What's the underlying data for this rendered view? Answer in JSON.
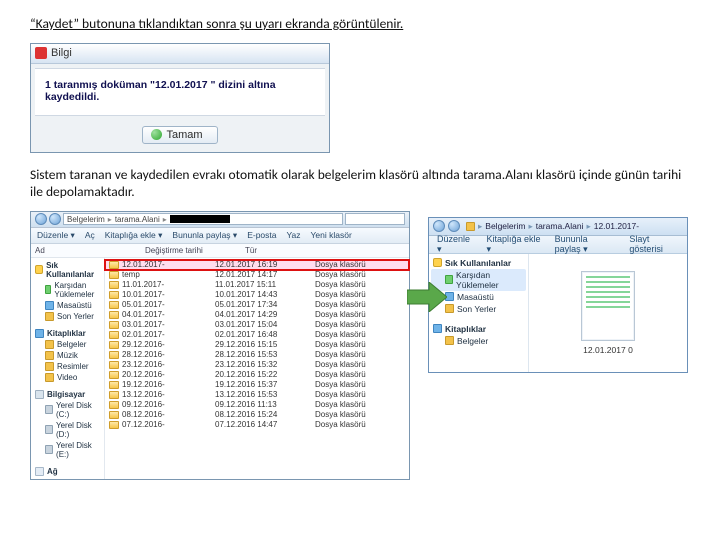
{
  "text": {
    "p1": "“Kaydet” butonuna tıklandıktan sonra şu uyarı ekranda görüntülenir.",
    "p2": "Sistem taranan ve kaydedilen evrakı otomatik olarak belgelerim klasörü altında tarama.Alanı klasörü içinde günün tarihi ile depolamaktadır."
  },
  "dialog": {
    "title": "Bilgi",
    "message": "1 taranmış doküman \"12.01.2017 \" dizini altına kaydedildi.",
    "ok": "Tamam"
  },
  "explorer": {
    "toolbar": {
      "duzenle": "Düzenle ▾",
      "ac": "Aç",
      "kitaplik": "Kitaplığa ekle ▾",
      "paylas": "Bununla paylaş ▾",
      "eposta": "E-posta",
      "yaz": "Yaz",
      "yeni": "Yeni klasör"
    },
    "addr": {
      "a": "Belgelerim",
      "b": "tarama.Alani"
    },
    "columns": {
      "ad": "Ad",
      "tarih": "Değiştirme tarihi",
      "tur": "Tür"
    },
    "side": {
      "sik": "Sık Kullanılanlar",
      "karsidan": "Karşıdan Yüklemeler",
      "masaustu": "Masaüstü",
      "son": "Son Yerler",
      "kitapliklar": "Kitaplıklar",
      "belgeler": "Belgeler",
      "muzik": "Müzik",
      "resimler": "Resimler",
      "video": "Video",
      "bilgisayar": "Bilgisayar",
      "yereldiskC": "Yerel Disk (C:)",
      "yereldiskD": "Yerel Disk (D:)",
      "yereldiskE": "Yerel Disk (E:)",
      "ag": "Ağ"
    },
    "rows": [
      {
        "name": "12.01.2017-",
        "date": "12.01.2017 16:19",
        "type": "Dosya klasörü",
        "sel": true
      },
      {
        "name": "temp",
        "date": "12.01.2017 14:17",
        "type": "Dosya klasörü"
      },
      {
        "name": "11.01.2017-",
        "date": "11.01.2017 15:11",
        "type": "Dosya klasörü"
      },
      {
        "name": "10.01.2017-",
        "date": "10.01.2017 14:43",
        "type": "Dosya klasörü"
      },
      {
        "name": "05.01.2017-",
        "date": "05.01.2017 17:34",
        "type": "Dosya klasörü"
      },
      {
        "name": "04.01.2017-",
        "date": "04.01.2017 14:29",
        "type": "Dosya klasörü"
      },
      {
        "name": "03.01.2017-",
        "date": "03.01.2017 15:04",
        "type": "Dosya klasörü"
      },
      {
        "name": "02.01.2017-",
        "date": "02.01.2017 16:48",
        "type": "Dosya klasörü"
      },
      {
        "name": "29.12.2016-",
        "date": "29.12.2016 15:15",
        "type": "Dosya klasörü"
      },
      {
        "name": "28.12.2016-",
        "date": "28.12.2016 15:53",
        "type": "Dosya klasörü"
      },
      {
        "name": "23.12.2016-",
        "date": "23.12.2016 15:32",
        "type": "Dosya klasörü"
      },
      {
        "name": "20.12.2016-",
        "date": "20.12.2016 15:22",
        "type": "Dosya klasörü"
      },
      {
        "name": "19.12.2016-",
        "date": "19.12.2016 15:37",
        "type": "Dosya klasörü"
      },
      {
        "name": "13.12.2016-",
        "date": "13.12.2016 15:53",
        "type": "Dosya klasörü"
      },
      {
        "name": "09.12.2016-",
        "date": "09.12.2016 11:13",
        "type": "Dosya klasörü"
      },
      {
        "name": "08.12.2016-",
        "date": "08.12.2016 15:24",
        "type": "Dosya klasörü"
      },
      {
        "name": "07.12.2016-",
        "date": "07.12.2016 14:47",
        "type": "Dosya klasörü"
      }
    ]
  },
  "explorer2": {
    "crumbs": {
      "a": "Belgelerim",
      "b": "tarama.Alani",
      "c": "12.01.2017-"
    },
    "toolbar": {
      "duzenle": "Düzenle ▾",
      "kitaplik": "Kitaplığa ekle ▾",
      "paylas": "Bununla paylaş ▾",
      "slayt": "Slayt gösterisi"
    },
    "side": {
      "sik": "Sık Kullanılanlar",
      "karsidan": "Karşıdan Yüklemeler",
      "masaustu": "Masaüstü",
      "son": "Son Yerler",
      "kitapliklar": "Kitaplıklar",
      "belgeler": "Belgeler"
    },
    "thumb": "12.01.2017 0"
  }
}
